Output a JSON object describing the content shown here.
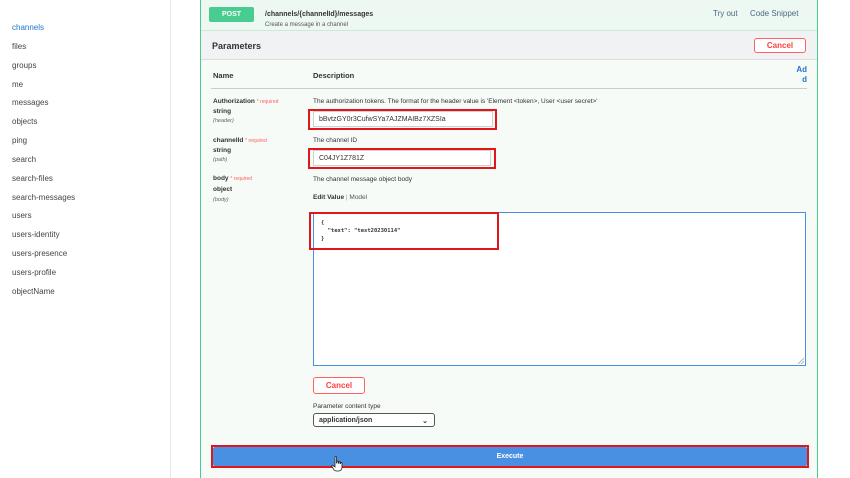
{
  "sidebar": {
    "items": [
      {
        "label": "channels",
        "active": true
      },
      {
        "label": "files"
      },
      {
        "label": "groups"
      },
      {
        "label": "me"
      },
      {
        "label": "messages"
      },
      {
        "label": "objects"
      },
      {
        "label": "ping"
      },
      {
        "label": "search"
      },
      {
        "label": "search-files"
      },
      {
        "label": "search-messages"
      },
      {
        "label": "users"
      },
      {
        "label": "users-identity"
      },
      {
        "label": "users-presence"
      },
      {
        "label": "users-profile"
      },
      {
        "label": "objectName"
      }
    ]
  },
  "operation": {
    "method": "POST",
    "path": "/channels/{channelId}/messages",
    "summary": "Create a message in a channel",
    "try_out": "Try out",
    "code_snippet": "Code Snippet"
  },
  "parameters": {
    "title": "Parameters",
    "cancel": "Cancel",
    "col_name": "Name",
    "col_description": "Description",
    "add_link": "Ad d",
    "required_text": "* required",
    "items": [
      {
        "name": "Authorization",
        "type": "string",
        "location": "(header)",
        "description": "The authorization tokens. The format for the header value is 'Element <token>, User <user secret>'",
        "value": "bBvtzGY0r3CufwSYa7AJZMAIBz7XZSIa"
      },
      {
        "name": "channelId",
        "type": "string",
        "location": "(path)",
        "description": "The channel ID",
        "value": "C04JY1Z781Z"
      },
      {
        "name": "body",
        "type": "object",
        "location": "(body)",
        "description": "The channel message object body"
      }
    ],
    "edit_value": "Edit Value",
    "model": "Model",
    "body_code": "{\n  \"text\": \"test20230114\"\n}",
    "cancel_bottom": "Cancel",
    "content_type_label": "Parameter content type",
    "content_type_value": "application/json"
  },
  "execute": {
    "label": "Execute"
  },
  "colors": {
    "accent": "#49cc90",
    "execute": "#4a90e2",
    "highlight": "#e0161b",
    "cancel": "#ff6060"
  }
}
